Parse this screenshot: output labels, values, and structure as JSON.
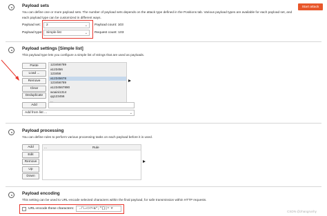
{
  "payload_sets": {
    "title": "Payload sets",
    "description_line1": "You can define one or more payload sets. The number of payload sets depends on the attack type defined in the Positions tab. Various payload types are available for each payload set, and",
    "description_line2": "each payload type can be customized in different ways.",
    "set_label": "Payload set:",
    "set_value": "2",
    "type_label": "Payload type:",
    "type_value": "Simple list",
    "payload_count_label": "Payload count: 103",
    "request_count_label": "Request count: 103",
    "start_attack_label": "Start attack"
  },
  "payload_settings": {
    "title": "Payload settings [Simple list]",
    "description": "This payload type lets you configure a simple list of strings that are used as payloads.",
    "buttons": {
      "paste": "Paste",
      "load": "Load ...",
      "remove": "Remove",
      "clear": "Clear",
      "deduplicate": "Deduplicate",
      "add": "Add"
    },
    "items": [
      "123456789",
      "a123456",
      "123456",
      "a12345678",
      "123456789",
      "a1234567890",
      "woaini1314",
      "qq123456",
      "..."
    ],
    "add_input_value": "",
    "add_from_list_label": "Add from list ..."
  },
  "payload_processing": {
    "title": "Payload processing",
    "description": "You can define rules to perform various processing tasks on each payload before it is used.",
    "buttons": {
      "add": "Add",
      "edit": "Edit",
      "remove": "Remove",
      "up": "Up",
      "down": "Down"
    },
    "table_header_col1": "...",
    "table_header_col2": "Rule"
  },
  "payload_encoding": {
    "title": "Payload encoding",
    "description": "This setting can be used to URL-encode selected characters within the final payload, for safe transmission within HTTP requests.",
    "checkbox_label": "URL-encode these characters:",
    "characters_value": "./\\=<>?+&*;\"{}|^`#",
    "checked": false
  },
  "watermark": "CSDN @zhangrunhy",
  "colors": {
    "accent": "#e8562a",
    "annotation_red": "#e8342a",
    "highlight_row": "#c5d8ec"
  }
}
